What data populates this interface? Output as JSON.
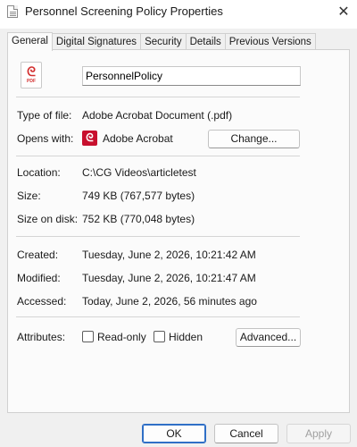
{
  "window": {
    "title": "Personnel Screening Policy Properties",
    "close": "✕"
  },
  "tabs": [
    {
      "label": "General",
      "active": true
    },
    {
      "label": "Digital Signatures"
    },
    {
      "label": "Security"
    },
    {
      "label": "Details"
    },
    {
      "label": "Previous Versions"
    }
  ],
  "general": {
    "file_icon_tag": "PDF",
    "file_name": "PersonnelPolicy",
    "type_of_file_label": "Type of file:",
    "type_of_file": "Adobe Acrobat Document (.pdf)",
    "opens_with_label": "Opens with:",
    "opens_with_app": "Adobe Acrobat",
    "change_button": "Change...",
    "location_label": "Location:",
    "location": "C:\\CG Videos\\articletest",
    "size_label": "Size:",
    "size": "749 KB (767,577 bytes)",
    "size_on_disk_label": "Size on disk:",
    "size_on_disk": "752 KB (770,048 bytes)",
    "created_label": "Created:",
    "created": "Tuesday, June 2, 2026, 10:21:42 AM",
    "modified_label": "Modified:",
    "modified": "Tuesday, June 2, 2026, 10:21:47 AM",
    "accessed_label": "Accessed:",
    "accessed": "Today, June 2, 2026, 56 minutes ago",
    "attributes_label": "Attributes:",
    "readonly_label": "Read-only",
    "readonly_checked": false,
    "hidden_label": "Hidden",
    "hidden_checked": false,
    "advanced_button": "Advanced..."
  },
  "footer": {
    "ok": "OK",
    "cancel": "Cancel",
    "apply": "Apply"
  },
  "colors": {
    "pdf_red": "#d32f2f",
    "acrobat_red": "#c8102e",
    "default_button_border": "#2f6fc6"
  }
}
